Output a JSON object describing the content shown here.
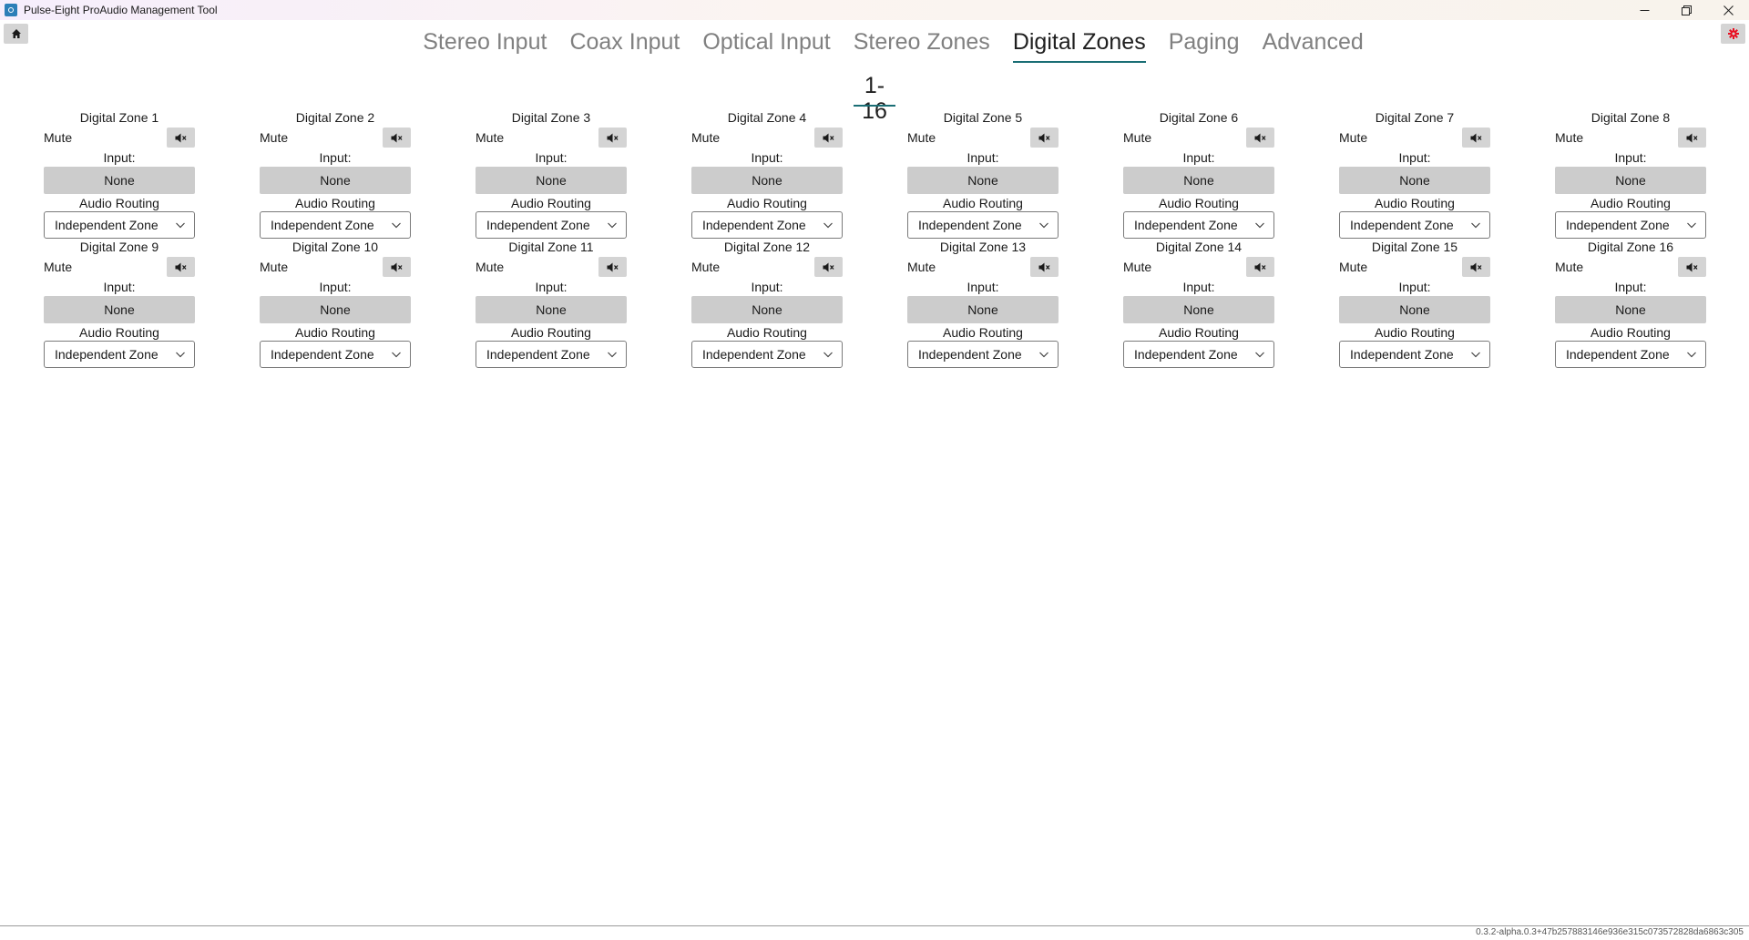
{
  "window": {
    "title": "Pulse-Eight ProAudio Management Tool"
  },
  "tabs": [
    {
      "label": "Stereo Input",
      "active": false
    },
    {
      "label": "Coax Input",
      "active": false
    },
    {
      "label": "Optical Input",
      "active": false
    },
    {
      "label": "Stereo Zones",
      "active": false
    },
    {
      "label": "Digital Zones",
      "active": true
    },
    {
      "label": "Paging",
      "active": false
    },
    {
      "label": "Advanced",
      "active": false
    }
  ],
  "subtab": {
    "label": "1-16"
  },
  "labels": {
    "mute": "Mute",
    "input": "Input:",
    "audio_routing": "Audio Routing"
  },
  "zones": [
    {
      "name": "Digital Zone 1",
      "input": "None",
      "routing": "Independent Zone"
    },
    {
      "name": "Digital Zone 2",
      "input": "None",
      "routing": "Independent Zone"
    },
    {
      "name": "Digital Zone 3",
      "input": "None",
      "routing": "Independent Zone"
    },
    {
      "name": "Digital Zone 4",
      "input": "None",
      "routing": "Independent Zone"
    },
    {
      "name": "Digital Zone 5",
      "input": "None",
      "routing": "Independent Zone"
    },
    {
      "name": "Digital Zone 6",
      "input": "None",
      "routing": "Independent Zone"
    },
    {
      "name": "Digital Zone 7",
      "input": "None",
      "routing": "Independent Zone"
    },
    {
      "name": "Digital Zone 8",
      "input": "None",
      "routing": "Independent Zone"
    },
    {
      "name": "Digital Zone 9",
      "input": "None",
      "routing": "Independent Zone"
    },
    {
      "name": "Digital Zone 10",
      "input": "None",
      "routing": "Independent Zone"
    },
    {
      "name": "Digital Zone 11",
      "input": "None",
      "routing": "Independent Zone"
    },
    {
      "name": "Digital Zone 12",
      "input": "None",
      "routing": "Independent Zone"
    },
    {
      "name": "Digital Zone 13",
      "input": "None",
      "routing": "Independent Zone"
    },
    {
      "name": "Digital Zone 14",
      "input": "None",
      "routing": "Independent Zone"
    },
    {
      "name": "Digital Zone 15",
      "input": "None",
      "routing": "Independent Zone"
    },
    {
      "name": "Digital Zone 16",
      "input": "None",
      "routing": "Independent Zone"
    }
  ],
  "footer": {
    "version": "0.3.2-alpha.0.3+47b257883146e936e315c073572828da6863c305"
  },
  "colors": {
    "accent": "#1a6e75",
    "button_bg": "#d4d4d4",
    "settings_icon": "#e81123"
  },
  "icons": {
    "home": "home-icon",
    "settings": "gear-icon",
    "mute": "speaker-mute-icon",
    "dropdown": "chevron-down-icon"
  }
}
